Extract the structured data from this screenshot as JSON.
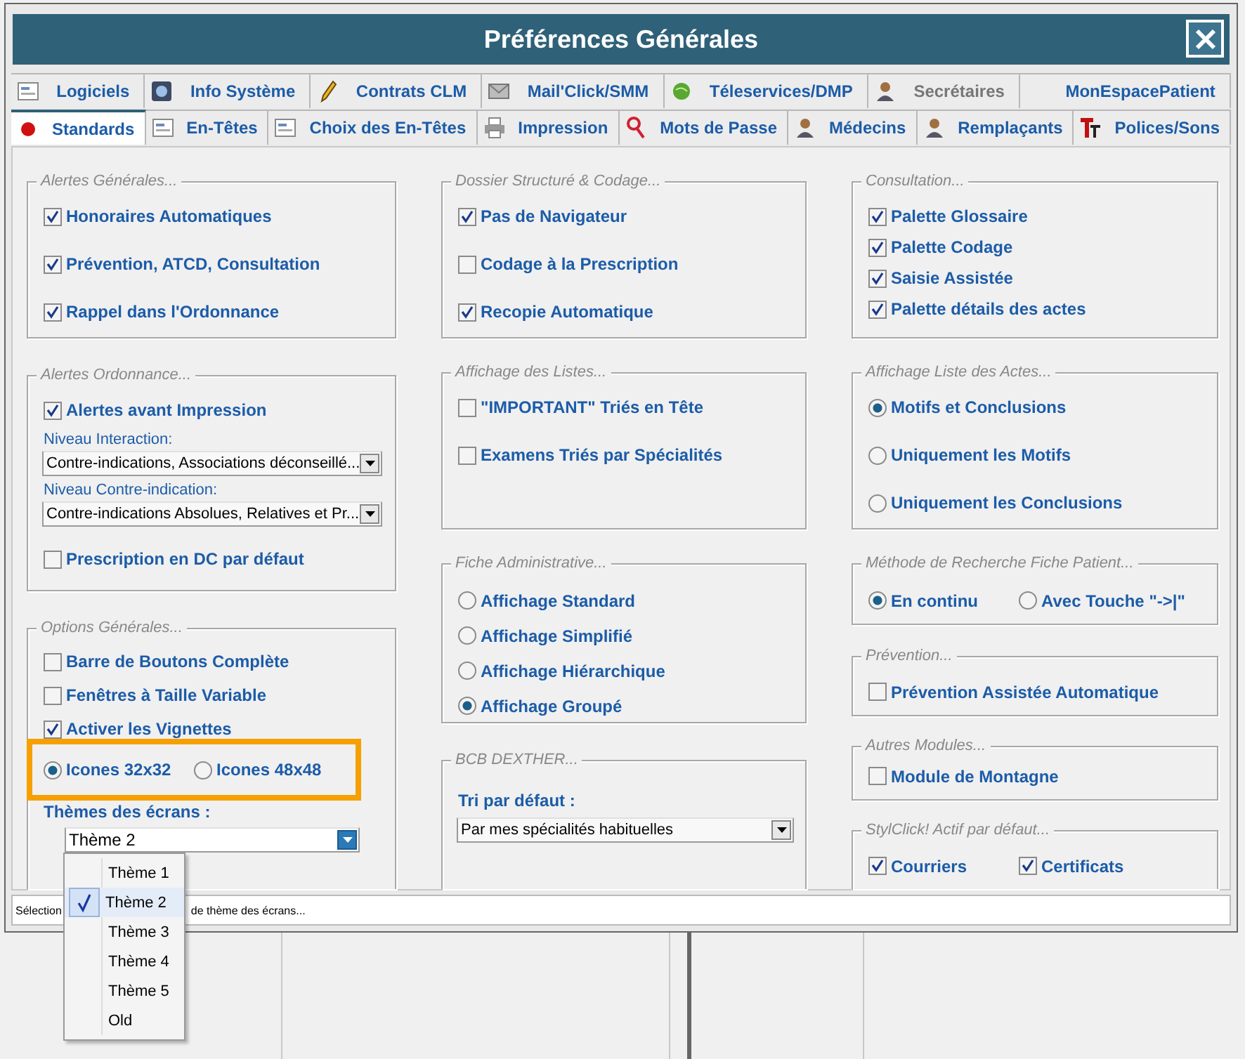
{
  "window": {
    "title": "Préférences Générales"
  },
  "tab_rows": [
    {
      "tabs": [
        {
          "label": "Logiciels",
          "selected": false,
          "disabled": false
        },
        {
          "label": "Info Système",
          "selected": false,
          "disabled": false
        },
        {
          "label": "Contrats CLM",
          "selected": false,
          "disabled": false
        },
        {
          "label": "Mail'Click/SMM",
          "selected": false,
          "disabled": false
        },
        {
          "label": "Téleservices/DMP",
          "selected": false,
          "disabled": false
        },
        {
          "label": "Secrétaires",
          "selected": false,
          "disabled": true
        },
        {
          "label": "MonEspacePatient",
          "selected": false,
          "disabled": false
        }
      ]
    },
    {
      "tabs": [
        {
          "label": "Standards",
          "selected": true,
          "disabled": false
        },
        {
          "label": "En-Têtes",
          "selected": false,
          "disabled": false
        },
        {
          "label": "Choix des En-Têtes",
          "selected": false,
          "disabled": false
        },
        {
          "label": "Impression",
          "selected": false,
          "disabled": false
        },
        {
          "label": "Mots de Passe",
          "selected": false,
          "disabled": false
        },
        {
          "label": "Médecins",
          "selected": false,
          "disabled": false
        },
        {
          "label": "Remplaçants",
          "selected": false,
          "disabled": false
        },
        {
          "label": "Polices/Sons",
          "selected": false,
          "disabled": false
        }
      ]
    }
  ],
  "columns": [
    {
      "groups": [
        {
          "title": "Alertes Générales...",
          "items": [
            {
              "kind": "checkbox",
              "label": "Honoraires Automatiques",
              "checked": true
            },
            {
              "kind": "checkbox",
              "label": "Prévention, ATCD, Consultation",
              "checked": true
            },
            {
              "kind": "checkbox",
              "label": "Rappel dans l'Ordonnance",
              "checked": true
            }
          ]
        },
        {
          "title": "Alertes Ordonnance...",
          "items": [
            {
              "kind": "checkbox",
              "label": "Alertes avant Impression",
              "checked": true
            },
            {
              "kind": "select",
              "label": "Niveau Interaction:",
              "value": "Contre-indications, Associations déconseillé..."
            },
            {
              "kind": "select",
              "label": "Niveau Contre-indication:",
              "value": "Contre-indications Absolues, Relatives et Pr..."
            },
            {
              "kind": "checkbox",
              "label": "Prescription en DC par défaut",
              "checked": false
            }
          ]
        },
        {
          "title": "Options Générales...",
          "items": [
            {
              "kind": "checkbox",
              "label": "Barre de Boutons Complète",
              "checked": false
            },
            {
              "kind": "checkbox",
              "label": "Fenêtres à Taille Variable",
              "checked": false
            },
            {
              "kind": "checkbox",
              "label": "Activer les Vignettes",
              "checked": true
            },
            {
              "kind": "choice_row",
              "highlighted": true,
              "options": [
                {
                  "kind": "radio",
                  "label": "Icones 32x32",
                  "selected": true
                },
                {
                  "kind": "radio",
                  "label": "Icones 48x48",
                  "selected": false
                }
              ]
            },
            {
              "kind": "combo",
              "label": "Thèmes des écrans :",
              "value": "Thème 2",
              "menu": [
                {
                  "label": "Thème 1",
                  "selected": false
                },
                {
                  "label": "Thème 2",
                  "selected": true
                },
                {
                  "label": "Thème 3",
                  "selected": false
                },
                {
                  "label": "Thème 4",
                  "selected": false
                },
                {
                  "label": "Thème 5",
                  "selected": false
                },
                {
                  "label": "Old",
                  "selected": false
                }
              ]
            }
          ]
        }
      ]
    },
    {
      "groups": [
        {
          "title": "Dossier Structuré & Codage...",
          "items": [
            {
              "kind": "checkbox",
              "label": "Pas de Navigateur",
              "checked": true
            },
            {
              "kind": "checkbox",
              "label": "Codage à la Prescription",
              "checked": false
            },
            {
              "kind": "checkbox",
              "label": "Recopie Automatique",
              "checked": true
            }
          ]
        },
        {
          "title": "Affichage des Listes...",
          "items": [
            {
              "kind": "checkbox",
              "label": "\"IMPORTANT\" Triés en Tête",
              "checked": false
            },
            {
              "kind": "checkbox",
              "label": "Examens Triés par Spécialités",
              "checked": false
            }
          ]
        },
        {
          "title": "Fiche Administrative...",
          "items": [
            {
              "kind": "radio",
              "label": "Affichage Standard",
              "selected": false
            },
            {
              "kind": "radio",
              "label": "Affichage Simplifié",
              "selected": false
            },
            {
              "kind": "radio",
              "label": "Affichage Hiérarchique",
              "selected": false
            },
            {
              "kind": "radio",
              "label": "Affichage Groupé",
              "selected": true
            }
          ]
        },
        {
          "title": "BCB DEXTHER...",
          "items": [
            {
              "kind": "combo",
              "label": "Tri par défaut :",
              "value": "Par mes spécialités habituelles"
            }
          ]
        }
      ]
    },
    {
      "groups": [
        {
          "title": "Consultation...",
          "items": [
            {
              "kind": "checkbox",
              "label": "Palette Glossaire",
              "checked": true
            },
            {
              "kind": "checkbox",
              "label": "Palette Codage",
              "checked": true
            },
            {
              "kind": "checkbox",
              "label": "Saisie Assistée",
              "checked": true
            },
            {
              "kind": "checkbox",
              "label": "Palette détails des actes",
              "checked": true
            }
          ]
        },
        {
          "title": "Affichage Liste des Actes...",
          "items": [
            {
              "kind": "radio",
              "label": "Motifs et Conclusions",
              "selected": true
            },
            {
              "kind": "radio",
              "label": "Uniquement les Motifs",
              "selected": false
            },
            {
              "kind": "radio",
              "label": "Uniquement les Conclusions",
              "selected": false
            }
          ]
        },
        {
          "title": "Méthode de Recherche Fiche Patient...",
          "items": [
            {
              "kind": "choice_row",
              "highlighted": false,
              "options": [
                {
                  "kind": "radio",
                  "label": "En continu",
                  "selected": true
                },
                {
                  "kind": "radio",
                  "label": "Avec Touche \"->|\"",
                  "selected": false
                }
              ]
            }
          ]
        },
        {
          "title": "Prévention...",
          "items": [
            {
              "kind": "checkbox",
              "label": "Prévention Assistée Automatique",
              "checked": false
            }
          ]
        },
        {
          "title": "Autres Modules...",
          "items": [
            {
              "kind": "checkbox",
              "label": "Module de Montagne",
              "checked": false
            }
          ]
        },
        {
          "title": "StylClick! Actif par défaut...",
          "items": [
            {
              "kind": "choice_row",
              "highlighted": false,
              "options": [
                {
                  "kind": "checkbox",
                  "label": "Courriers",
                  "checked": true
                },
                {
                  "kind": "checkbox",
                  "label": "Certificats",
                  "checked": true
                }
              ]
            }
          ]
        }
      ]
    }
  ],
  "status_bar": {
    "texts": [
      "Sélection",
      "de thème des écrans..."
    ]
  }
}
